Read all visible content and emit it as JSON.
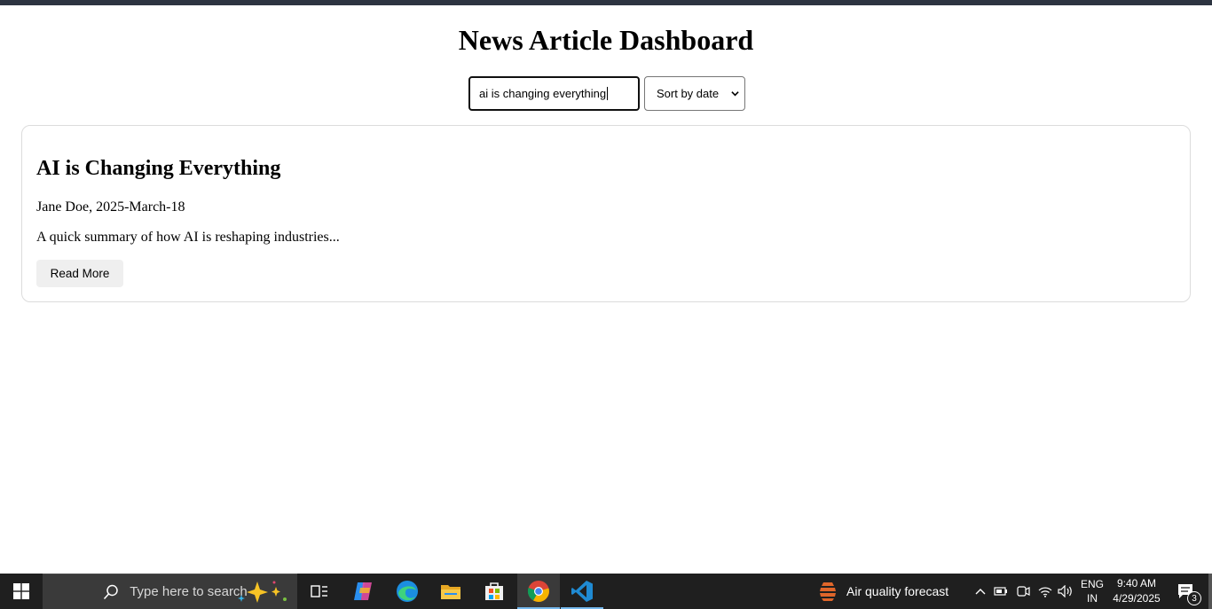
{
  "page": {
    "title": "News Article Dashboard",
    "search": {
      "value": "ai is changing everything"
    },
    "sort": {
      "selected": "Sort by date"
    }
  },
  "articles": [
    {
      "title": "AI is Changing Everything",
      "meta": "Jane Doe, 2025-March-18",
      "summary": "A quick summary of how AI is reshaping industries...",
      "button_label": "Read More"
    }
  ],
  "taskbar": {
    "search_placeholder": "Type here to search",
    "weather_label": "Air quality forecast",
    "lang_line1": "ENG",
    "lang_line2": "IN",
    "time": "9:40 AM",
    "date": "4/29/2025",
    "notification_count": "3",
    "apps": [
      "windows-start-icon",
      "search-icon",
      "copilot-sparkle-icon",
      "task-view-icon",
      "copilot-icon",
      "edge-icon",
      "file-explorer-icon",
      "microsoft-store-icon",
      "chrome-icon",
      "vscode-icon"
    ]
  },
  "colors": {
    "top_bar": "#2d3441",
    "taskbar": "#1f1f1f",
    "accent_line": "#76b9ed"
  }
}
